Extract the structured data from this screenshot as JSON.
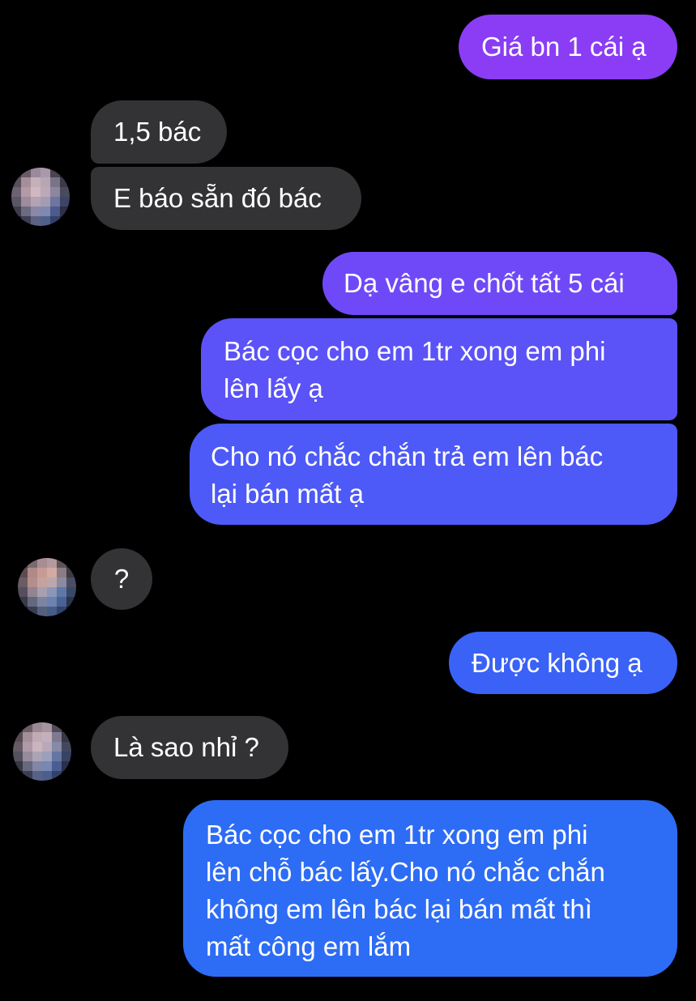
{
  "conversation": {
    "messages": [
      {
        "sender": "me",
        "text": "Giá bn 1 cái ạ"
      },
      {
        "sender": "other",
        "text": "1,5 bác"
      },
      {
        "sender": "other",
        "text": "E báo sẵn đó bác"
      },
      {
        "sender": "me",
        "text": "Dạ vâng e chốt tất 5 cái"
      },
      {
        "sender": "me",
        "text": "Bác cọc cho em 1tr xong em phi\nlên lấy ạ"
      },
      {
        "sender": "me",
        "text": "Cho nó chắc chắn trả em lên bác\nlại bán mất ạ"
      },
      {
        "sender": "other",
        "text": "?"
      },
      {
        "sender": "me",
        "text": "Được không ạ"
      },
      {
        "sender": "other",
        "text": "Là sao nhỉ ?"
      },
      {
        "sender": "me",
        "text": "Bác cọc cho em 1tr xong em phi\nlên chỗ bác lấy.Cho nó chắc chắn\nkhông em lên bác lại bán mất thì\nmất công em lắm"
      }
    ]
  },
  "colors": {
    "background": "#000000",
    "incoming_bubble": "#333335",
    "outgoing_gradient_top": "#8a3df5",
    "outgoing_gradient_bottom": "#2d6cf5",
    "text": "#ffffff"
  },
  "avatars": [
    {
      "icon": "pixelated-avatar-icon",
      "state": "blurred"
    },
    {
      "icon": "pixelated-avatar-icon",
      "state": "blurred"
    },
    {
      "icon": "pixelated-avatar-icon",
      "state": "blurred"
    }
  ]
}
